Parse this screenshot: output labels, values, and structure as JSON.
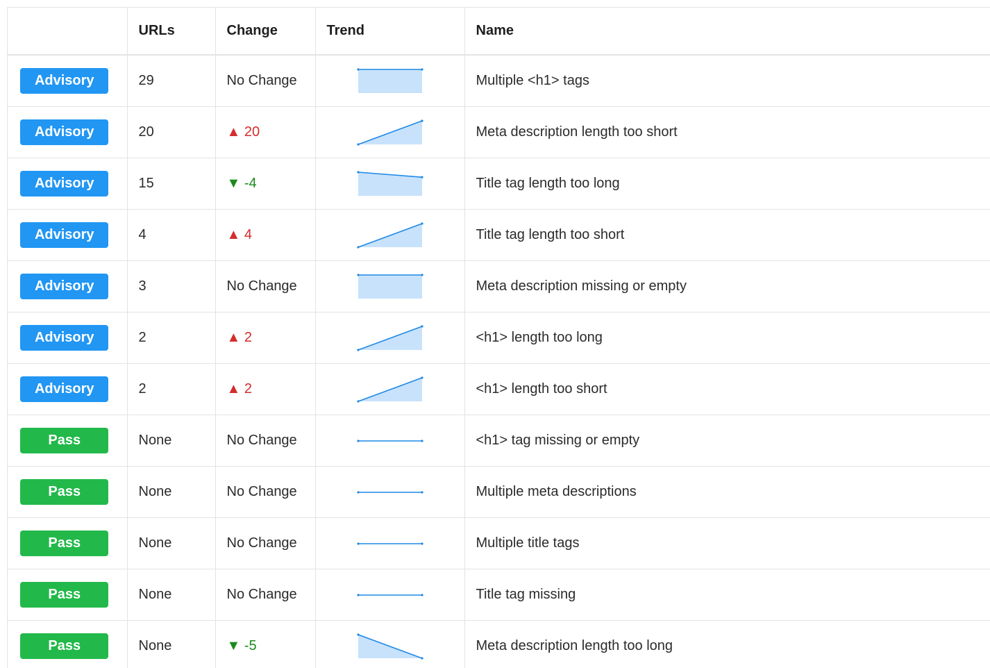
{
  "table": {
    "headers": {
      "status": "",
      "urls": "URLs",
      "change": "Change",
      "trend": "Trend",
      "name": "Name"
    },
    "rows": [
      {
        "status": "Advisory",
        "urls": "29",
        "change": "No Change",
        "change_dir": "none",
        "trend": [
          29,
          29
        ],
        "trend_style": "area",
        "name": "Multiple <h1> tags"
      },
      {
        "status": "Advisory",
        "urls": "20",
        "change": "▲ 20",
        "change_dir": "up",
        "trend": [
          0,
          20
        ],
        "trend_style": "area",
        "name": "Meta description length too short"
      },
      {
        "status": "Advisory",
        "urls": "15",
        "change": "▼ -4",
        "change_dir": "down",
        "trend": [
          19,
          15
        ],
        "trend_style": "area",
        "name": "Title tag length too long"
      },
      {
        "status": "Advisory",
        "urls": "4",
        "change": "▲ 4",
        "change_dir": "up",
        "trend": [
          0,
          4
        ],
        "trend_style": "area",
        "name": "Title tag length too short"
      },
      {
        "status": "Advisory",
        "urls": "3",
        "change": "No Change",
        "change_dir": "none",
        "trend": [
          3,
          3
        ],
        "trend_style": "area",
        "name": "Meta description missing or empty"
      },
      {
        "status": "Advisory",
        "urls": "2",
        "change": "▲ 2",
        "change_dir": "up",
        "trend": [
          0,
          2
        ],
        "trend_style": "area",
        "name": "<h1> length too long"
      },
      {
        "status": "Advisory",
        "urls": "2",
        "change": "▲ 2",
        "change_dir": "up",
        "trend": [
          0,
          2
        ],
        "trend_style": "area",
        "name": "<h1> length too short"
      },
      {
        "status": "Pass",
        "urls": "None",
        "change": "No Change",
        "change_dir": "none",
        "trend": [
          0,
          0
        ],
        "trend_style": "flat",
        "name": "<h1> tag missing or empty"
      },
      {
        "status": "Pass",
        "urls": "None",
        "change": "No Change",
        "change_dir": "none",
        "trend": [
          0,
          0
        ],
        "trend_style": "flat",
        "name": "Multiple meta descriptions"
      },
      {
        "status": "Pass",
        "urls": "None",
        "change": "No Change",
        "change_dir": "none",
        "trend": [
          0,
          0
        ],
        "trend_style": "flat",
        "name": "Multiple title tags"
      },
      {
        "status": "Pass",
        "urls": "None",
        "change": "No Change",
        "change_dir": "none",
        "trend": [
          0,
          0
        ],
        "trend_style": "flat",
        "name": "Title tag missing"
      },
      {
        "status": "Pass",
        "urls": "None",
        "change": "▼ -5",
        "change_dir": "down",
        "trend": [
          5,
          0
        ],
        "trend_style": "area",
        "name": "Meta description length too long"
      }
    ]
  },
  "colors": {
    "advisory": "#2196f3",
    "pass": "#22b94a",
    "up": "#d32d2d",
    "down": "#1c8a1c",
    "spark_line": "#1e88e5",
    "spark_fill": "#c8e2fb"
  }
}
